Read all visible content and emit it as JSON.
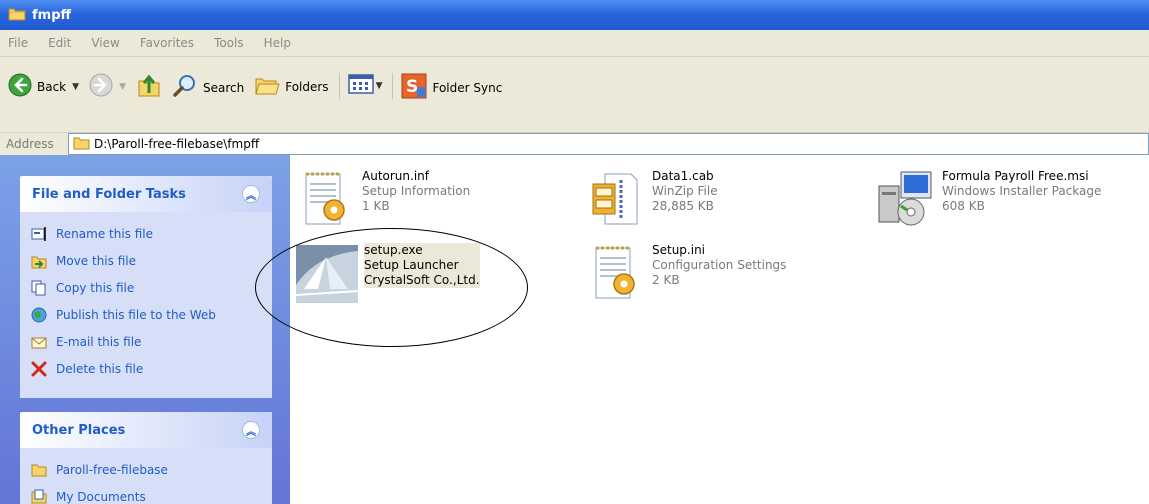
{
  "window": {
    "title": "fmpff"
  },
  "menu": [
    "File",
    "Edit",
    "View",
    "Favorites",
    "Tools",
    "Help"
  ],
  "toolbar": {
    "back_label": "Back",
    "search_label": "Search",
    "folders_label": "Folders",
    "folder_sync_label": "Folder Sync"
  },
  "address": {
    "label": "Address",
    "path": "D:\\Paroll-free-filebase\\fmpff"
  },
  "file_tasks": {
    "header": "File and Folder Tasks",
    "items": [
      {
        "label": "Rename this file",
        "icon": "rename-icon"
      },
      {
        "label": "Move this file",
        "icon": "move-icon"
      },
      {
        "label": "Copy this file",
        "icon": "copy-icon"
      },
      {
        "label": "Publish this file to the Web",
        "icon": "globe-icon"
      },
      {
        "label": "E-mail this file",
        "icon": "email-icon"
      },
      {
        "label": "Delete this file",
        "icon": "delete-icon"
      }
    ]
  },
  "other_places": {
    "header": "Other Places",
    "items": [
      {
        "label": "Paroll-free-filebase",
        "icon": "folder-icon"
      },
      {
        "label": "My Documents",
        "icon": "my-documents-icon"
      }
    ]
  },
  "files": [
    {
      "name": "Autorun.inf",
      "type": "Setup Information",
      "size": "1 KB",
      "icon": "settings-file-icon"
    },
    {
      "name": "Data1.cab",
      "type": "WinZip File",
      "size": "28,885 KB",
      "icon": "cabinet-icon"
    },
    {
      "name": "Formula Payroll Free.msi",
      "type": "Windows Installer Package",
      "size": "608 KB",
      "icon": "installer-icon"
    },
    {
      "name": "setup.exe",
      "type": "Setup Launcher",
      "size": "CrystalSoft Co.,Ltd.",
      "icon": "setup-exe-icon"
    },
    {
      "name": "Setup.ini",
      "type": "Configuration Settings",
      "size": "2 KB",
      "icon": "settings-file-icon"
    }
  ]
}
